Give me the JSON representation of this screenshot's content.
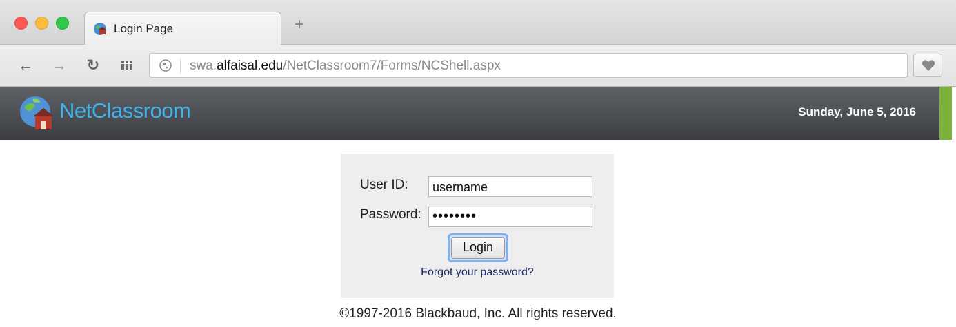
{
  "browser": {
    "tab": {
      "title": "Login Page",
      "favicon": "netclassroom-globe-icon"
    },
    "new_tab_label": "+",
    "toolbar": {
      "back_icon": "back-arrow-icon",
      "forward_icon": "forward-arrow-icon",
      "reload_icon": "reload-icon",
      "apps_icon": "apps-grid-icon",
      "url": {
        "prefix": "swa.",
        "host": "alfaisal.edu",
        "path": "/NetClassroom7/Forms/NCShell.aspx"
      },
      "bookmark_icon": "heart-icon"
    },
    "colors": {
      "traffic_red": "#fc5753",
      "traffic_yellow": "#fdbc40",
      "traffic_green": "#34c84a"
    }
  },
  "site": {
    "name": "NetClassroom",
    "date": "Sunday, June 5, 2016",
    "colors": {
      "brand": "#3fb3ea",
      "accent": "#7bb23b",
      "header": "#4b4d52"
    }
  },
  "login": {
    "user_label": "User ID:",
    "user_value": "username",
    "password_label": "Password:",
    "password_value": "••••••••",
    "button_label": "Login",
    "forgot_link": "Forgot your password?"
  },
  "footer": {
    "copyright": "©1997-2016 Blackbaud, Inc. All rights reserved."
  }
}
